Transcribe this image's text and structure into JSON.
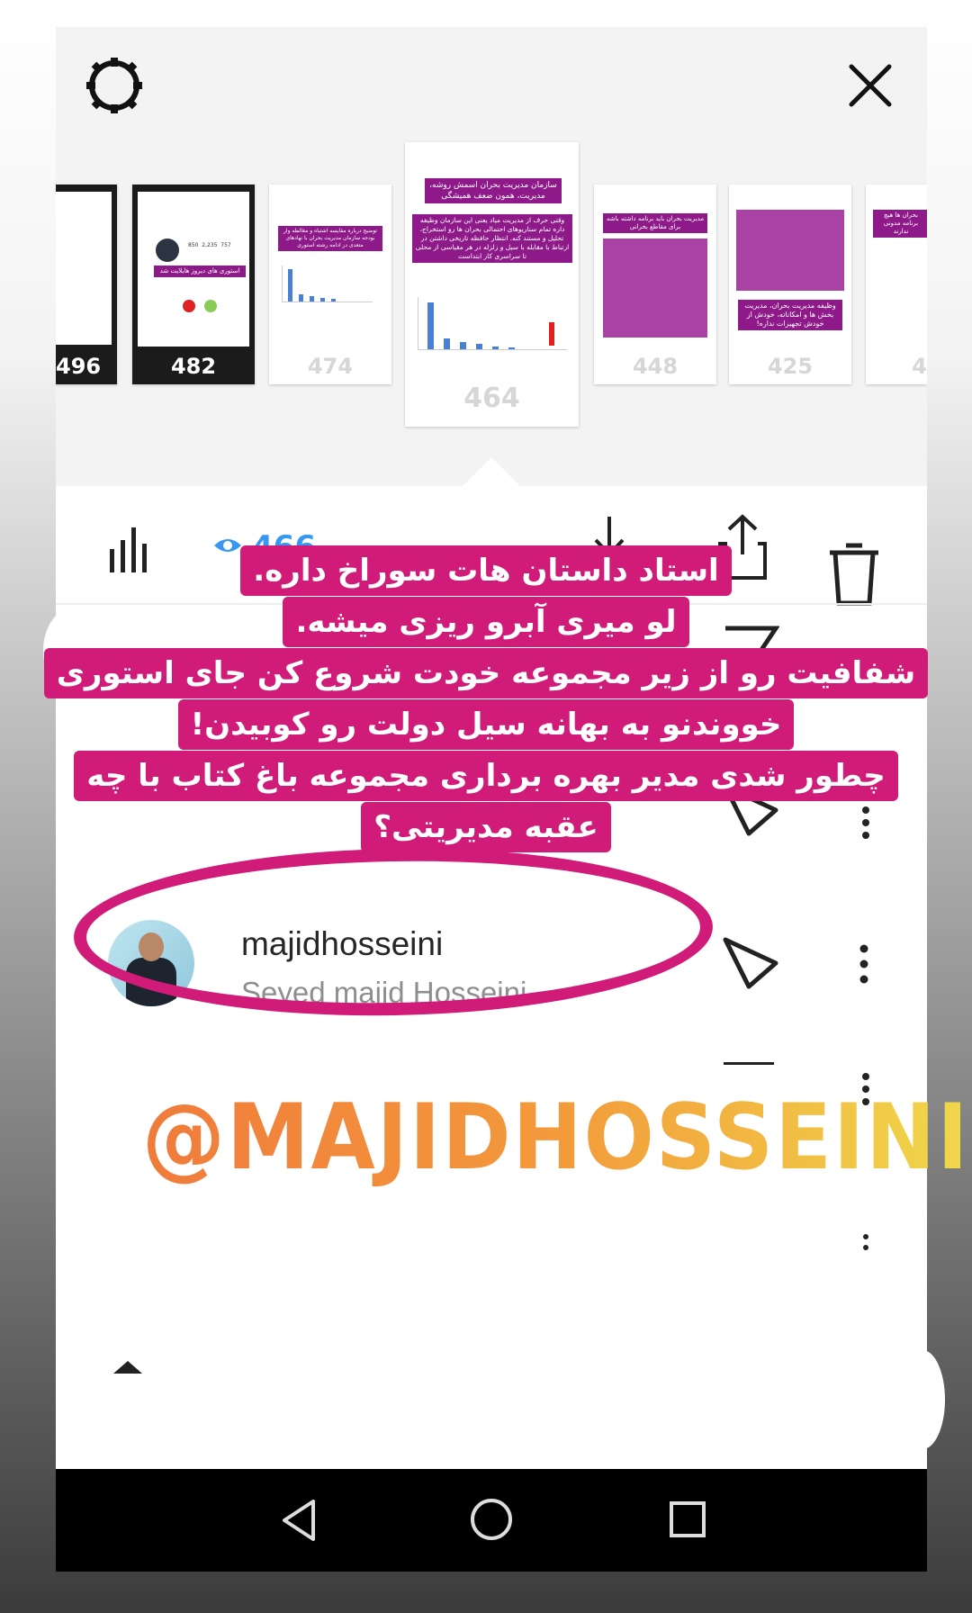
{
  "story_thumbnails": [
    {
      "count": "496",
      "style": "dark"
    },
    {
      "count": "482",
      "style": "dark",
      "banner": "استوری های دیروز هایلایت شد",
      "profile_stats": [
        "850",
        "2,235",
        "757"
      ]
    },
    {
      "count": "474",
      "banner": "توضیح درباره مقایسه اشتباه و مغالطه وار بودجه سازمان مدیریت بحران با نهادهای متعدی در ادامه رشته استوری"
    },
    {
      "count": "464",
      "selected": true,
      "banner": "سازمان مدیریت بحران اسمش روشه، مدیریت، همون ضعف همیشگی",
      "text": "وقتی حرف از مدیریت میاد یعنی این سازمان وظیفه داره تمام سناریوهای احتمالی بحران ها رو استخراج، تحلیل و مستند کنه. انتظار حافظه تاریخی داشتن در ارتباط با مقابله با سیل و زلزله در هر مقیاسی از محلی تا سراسری کار ابتداست"
    },
    {
      "count": "448",
      "text": "مدیریت بحران باید برنامه داشته باشه برای مقاطع بحرانی"
    },
    {
      "count": "425",
      "text": "وظیفه مدیریت بحران، مدیریت بخش ها و امکاناته، خودش از خودش تجهیزات نداره!"
    },
    {
      "count": "4",
      "text": "بحران ها هیچ برنامه مدونی ندارند"
    }
  ],
  "toolbar": {
    "views": "466"
  },
  "caption_lines": [
    "استاد داستان هات سوراخ داره.",
    "لو میری آبرو ریزی میشه.",
    "شفافیت رو از زیر مجموعه خودت شروع کن جای استوری",
    "خووندنو به بهانه سیل دولت رو کوبیدن!",
    "چطور شدی مدیر بهره برداری مجموعه باغ کتاب با چه",
    "عقبه مدیریتی؟"
  ],
  "viewer": {
    "username": "majidhosseini",
    "fullname": "Seyed majid Hosseini"
  },
  "mention_sticker": "@MAJIDHOSSEINI",
  "colors": {
    "highlight": "#d01b78",
    "views": "#3897f0",
    "mention_start": "#f07b3b",
    "mention_end": "#f0d84a"
  }
}
